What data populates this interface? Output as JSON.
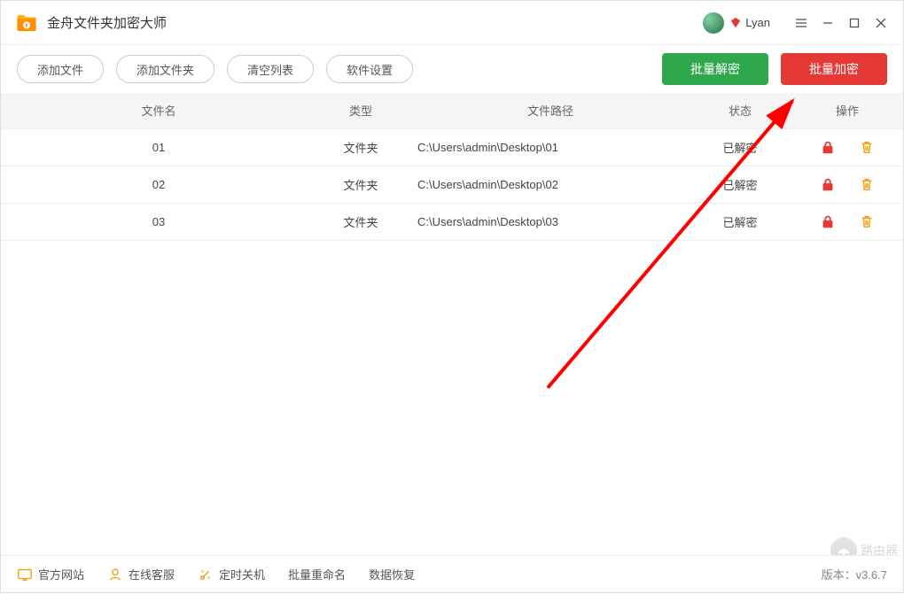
{
  "app": {
    "title": "金舟文件夹加密大师"
  },
  "user": {
    "name": "Lyan"
  },
  "toolbar": {
    "add_file": "添加文件",
    "add_folder": "添加文件夹",
    "clear_list": "清空列表",
    "settings": "软件设置",
    "batch_decrypt": "批量解密",
    "batch_encrypt": "批量加密"
  },
  "table": {
    "headers": {
      "name": "文件名",
      "type": "类型",
      "path": "文件路径",
      "status": "状态",
      "action": "操作"
    },
    "rows": [
      {
        "name": "01",
        "type": "文件夹",
        "path": "C:\\Users\\admin\\Desktop\\01",
        "status": "已解密"
      },
      {
        "name": "02",
        "type": "文件夹",
        "path": "C:\\Users\\admin\\Desktop\\02",
        "status": "已解密"
      },
      {
        "name": "03",
        "type": "文件夹",
        "path": "C:\\Users\\admin\\Desktop\\03",
        "status": "已解密"
      }
    ]
  },
  "footer": {
    "official_site": "官方网站",
    "support": "在线客服",
    "timer_shutdown": "定时关机",
    "batch_rename": "批量重命名",
    "data_recovery": "数据恢复",
    "version": "版本：v3.6.7"
  },
  "watermark": {
    "text": "路由器"
  },
  "colors": {
    "accent_green": "#2fa74c",
    "accent_red": "#e53935",
    "icon_orange": "#f59e0b"
  }
}
